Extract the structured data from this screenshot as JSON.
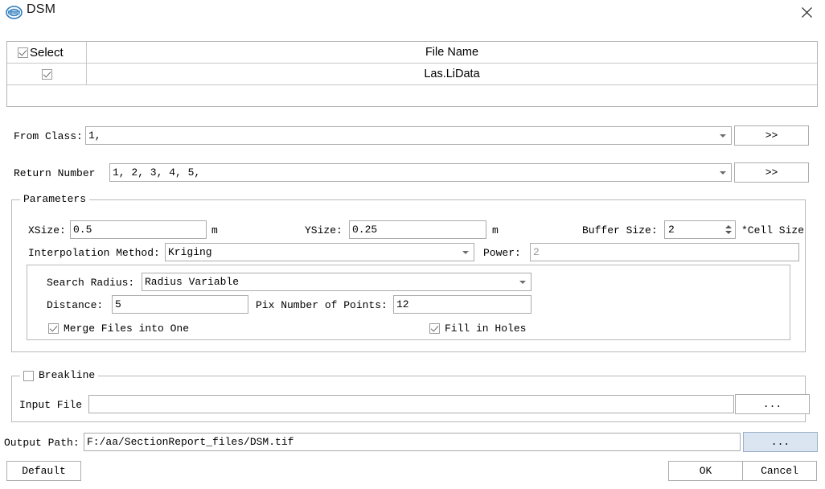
{
  "window": {
    "title": "DSM",
    "logo_icon": "lidar360-logo-icon",
    "close_icon": "close-icon"
  },
  "file_table": {
    "columns": [
      "Select",
      "File Name"
    ],
    "header_checkbox_checked": true,
    "rows": [
      {
        "selected": true,
        "file_name": "Las.LiData"
      }
    ]
  },
  "filters": {
    "from_class_label": "From Class:",
    "from_class_value": "1,",
    "from_class_more_button": ">>",
    "return_number_label": "Return Number",
    "return_number_value": "1, 2, 3, 4, 5,",
    "return_number_more_button": ">>"
  },
  "parameters": {
    "title": "Parameters",
    "xsize_label": "XSize:",
    "xsize_value": "0.5",
    "xsize_unit": "m",
    "ysize_label": "YSize:",
    "ysize_value": "0.25",
    "ysize_unit": "m",
    "buffer_size_label": "Buffer Size:",
    "buffer_size_value": "2",
    "buffer_size_unit": "*Cell Size",
    "interpolation_label": "Interpolation Method:",
    "interpolation_value": "Kriging",
    "power_label": "Power:",
    "power_value": "2",
    "power_disabled": true,
    "search_radius_label": "Search Radius:",
    "search_radius_value": "Radius Variable",
    "distance_label": "Distance:",
    "distance_value": "5",
    "pix_number_label": "Pix Number of Points:",
    "pix_number_value": "12",
    "merge_files_label": "Merge Files into One",
    "merge_files_checked": true,
    "fill_holes_label": "Fill in Holes",
    "fill_holes_checked": true
  },
  "breakline": {
    "title": "Breakline",
    "enabled": false,
    "input_file_label": "Input File",
    "input_file_value": "",
    "browse_button": "..."
  },
  "output": {
    "label": "Output Path:",
    "value": "F:/aa/SectionReport_files/DSM.tif",
    "browse_button": "...",
    "browse_button_active": true
  },
  "footer": {
    "default_button": "Default",
    "ok_button": "OK",
    "cancel_button": "Cancel"
  },
  "colors": {
    "accent": "#dbe5f1",
    "border": "#ababab",
    "logo_blue": "#2b7bbd"
  }
}
